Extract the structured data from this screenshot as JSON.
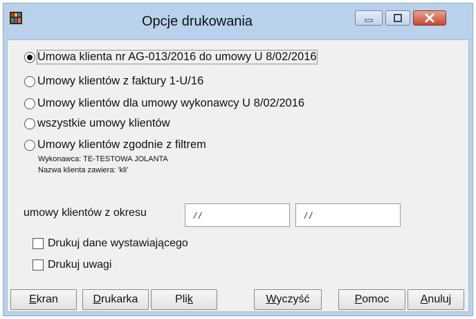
{
  "window": {
    "title": "Opcje drukowania"
  },
  "options": [
    {
      "label": "Umowa klienta nr AG-013/2016 do umowy U 8/02/2016",
      "checked": true
    },
    {
      "label": "Umowy klientów z faktury 1-U/16",
      "checked": false
    },
    {
      "label": "Umowy klientów dla umowy wykonawcy U 8/02/2016",
      "checked": false
    },
    {
      "label": "wszystkie umowy klientów",
      "checked": false
    },
    {
      "label": "Umowy klientów zgodnie z filtrem",
      "checked": false
    }
  ],
  "filter_notes": {
    "contractor": "Wykonawca: TE-TESTOWA JOLANTA",
    "client_name": "Nazwa klienta zawiera: 'kli'"
  },
  "period": {
    "label": "umowy klientów z okresu",
    "from": "/ /",
    "to": "/ /"
  },
  "checkboxes": [
    {
      "label": "Drukuj dane wystawiającego",
      "checked": false
    },
    {
      "label": "Drukuj uwagi",
      "checked": false
    }
  ],
  "buttons": {
    "screen": {
      "hotkey": "E",
      "rest": "kran"
    },
    "printer": {
      "hotkey": "D",
      "rest": "rukarka"
    },
    "file": {
      "pre": "Pli",
      "hotkey": "k"
    },
    "clear": {
      "hotkey": "W",
      "rest": "yczyść"
    },
    "help": {
      "hotkey": "P",
      "rest": "omoc"
    },
    "cancel": {
      "hotkey": "A",
      "rest": "nuluj"
    }
  }
}
